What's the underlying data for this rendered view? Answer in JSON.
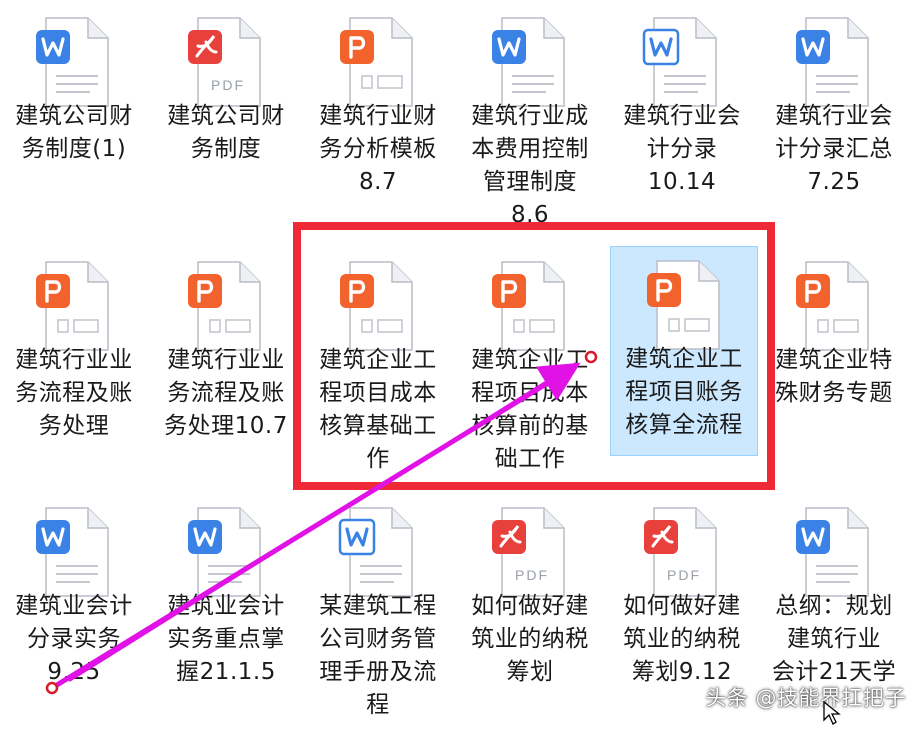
{
  "files": [
    {
      "type": "word",
      "label": "建筑公司财\n务制度(1)",
      "selected": false
    },
    {
      "type": "pdf",
      "label": "建筑公司财\n务制度",
      "selected": false
    },
    {
      "type": "ppt",
      "label": "建筑行业财\n务分析模板\n8.7",
      "selected": false
    },
    {
      "type": "word",
      "label": "建筑行业成\n本费用控制\n管理制度\n8.6",
      "selected": false
    },
    {
      "type": "doc",
      "label": "建筑行业会\n计分录\n10.14",
      "selected": false
    },
    {
      "type": "word",
      "label": "建筑行业会\n计分录汇总\n7.25",
      "selected": false
    },
    {
      "type": "ppt",
      "label": "建筑行业业\n务流程及账\n务处理",
      "selected": false
    },
    {
      "type": "ppt",
      "label": "建筑行业业\n务流程及账\n务处理10.7",
      "selected": false
    },
    {
      "type": "ppt",
      "label": "建筑企业工\n程项目成本\n核算基础工\n作",
      "selected": false
    },
    {
      "type": "ppt",
      "label": "建筑企业工\n程项目成本\n核算前的基\n础工作",
      "selected": false
    },
    {
      "type": "ppt",
      "label": "建筑企业工\n程项目账务\n核算全流程",
      "selected": true
    },
    {
      "type": "ppt",
      "label": "建筑企业特\n殊财务专题",
      "selected": false
    },
    {
      "type": "word",
      "label": "建筑业会计\n分录实务\n9.25",
      "selected": false
    },
    {
      "type": "word",
      "label": "建筑业会计\n实务重点掌\n握21.1.5",
      "selected": false
    },
    {
      "type": "doc",
      "label": "某建筑工程\n公司财务管\n理手册及流\n程",
      "selected": false
    },
    {
      "type": "pdf",
      "label": "如何做好建\n筑业的纳税\n筹划",
      "selected": false
    },
    {
      "type": "pdf",
      "label": "如何做好建\n筑业的纳税\n筹划9.12",
      "selected": false
    },
    {
      "type": "word",
      "label": "总纲：规划\n建筑行业\n会计21天学",
      "selected": false
    }
  ],
  "icon_text": {
    "pdf": "PDF"
  },
  "colors": {
    "word": "#3b82e6",
    "ppt": "#f2622c",
    "pdf": "#e8413c",
    "highlight_box": "#ef2a36",
    "arrow": "#e012e6",
    "selection": "#cce8ff"
  },
  "watermark": "头条 @技能界扛把子"
}
